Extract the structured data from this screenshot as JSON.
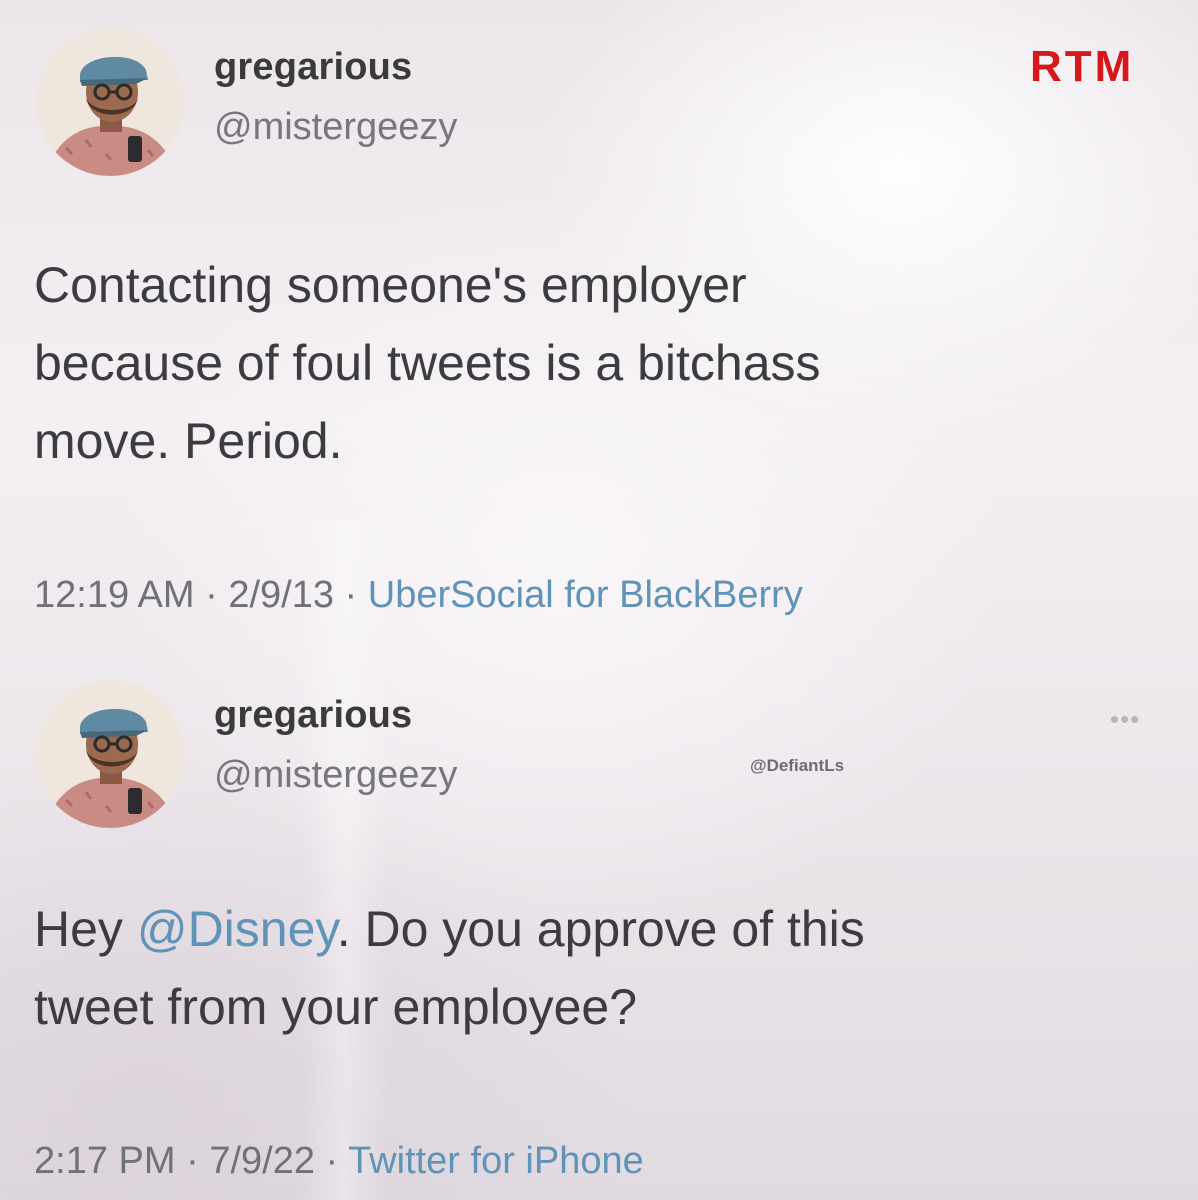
{
  "brand_logo": "RTM",
  "brand_color": "#d6171c",
  "link_color": "#5f93b8",
  "watermark": "@DefiantLs",
  "tweets": [
    {
      "display_name": "gregarious",
      "handle": "@mistergeezy",
      "avatar_icon": "user-avatar-icon",
      "text_lines": [
        "Contacting someone's employer",
        "because of foul tweets is a bitchass",
        "move. Period."
      ],
      "time": "12:19 AM",
      "date": "2/9/13",
      "source": "UberSocial for BlackBerry"
    },
    {
      "display_name": "gregarious",
      "handle": "@mistergeezy",
      "avatar_icon": "user-avatar-icon",
      "more_icon": "more-options-icon",
      "more_label": "•••",
      "text_parts": {
        "before": "Hey ",
        "mention": "@Disney",
        "after": ". Do you approve of this",
        "line2": "tweet from your employee?"
      },
      "time": "2:17 PM",
      "date": "7/9/22",
      "source": "Twitter for iPhone"
    }
  ],
  "separator": " · "
}
